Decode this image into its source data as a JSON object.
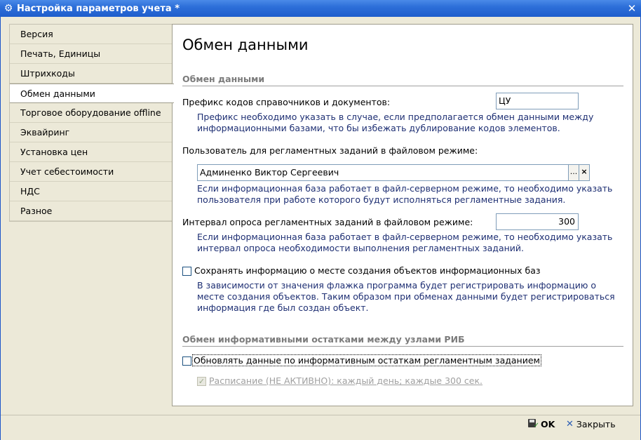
{
  "window": {
    "title": "Настройка параметров учета *",
    "icon": "gear-icon",
    "close_glyph": "✕"
  },
  "sidebar": {
    "items": [
      {
        "label": "Версия"
      },
      {
        "label": "Печать, Единицы"
      },
      {
        "label": "Штрихкоды"
      },
      {
        "label": "Обмен данными"
      },
      {
        "label": "Торговое оборудование offline"
      },
      {
        "label": "Эквайринг"
      },
      {
        "label": "Установка цен"
      },
      {
        "label": "Учет себестоимости"
      },
      {
        "label": "НДС"
      },
      {
        "label": "Разное"
      }
    ],
    "active_index": 3
  },
  "main": {
    "title": "Обмен данными",
    "section1": {
      "header": "Обмен данными",
      "prefix_label": "Префикс кодов справочников и документов:",
      "prefix_value": "ЦУ",
      "prefix_hint_1": "Префикс необходимо указать в случае, если предполагается обмен данными между",
      "prefix_hint_2": "информационными базами, что бы избежать дублирование кодов элементов.",
      "user_label": "Пользователь для регламентных заданий в файловом режиме:",
      "user_value": "Админенко Виктор Сергеевич",
      "select_button": "...",
      "clear_button": "×",
      "user_hint_1": "Если информационная база работает в файл-серверном режиме, то необходимо указать",
      "user_hint_2": "пользователя при работе которого будут исполняться регламентные задания.",
      "interval_label": "Интервал опроса регламентных заданий в файловом режиме:",
      "interval_value": "300",
      "interval_hint_1": "Если информационная база работает в файл-серверном режиме, то необходимо указать",
      "interval_hint_2": "интервал опроса необходимости выполнения регламентных заданий.",
      "save_info_label": "Сохранять информацию о месте создания объектов информационных баз",
      "save_info_checked": false,
      "save_info_hint_1": "В зависимости от значения флажка программа будет регистрировать информацию о",
      "save_info_hint_2": "месте создания объектов. Таким образом при обменах данными будет регистрироваться",
      "save_info_hint_3": "информация где был создан объект."
    },
    "section2": {
      "header": "Обмен информативными остатками между узлами РИБ",
      "update_label": "Обновлять данные по информативным остаткам регламентным заданием",
      "update_checked": false,
      "schedule_label": "Расписание (НЕ АКТИВНО): каждый день; каждые 300 сек.",
      "schedule_checked": true
    }
  },
  "footer": {
    "ok_label": "OK",
    "close_label": "Закрыть",
    "close_glyph": "✕"
  },
  "colors": {
    "titlebar": "#2d6fd9",
    "hint_text": "#1e2f73",
    "section_header": "#7b7b7b",
    "window_bg": "#ece9d8"
  }
}
